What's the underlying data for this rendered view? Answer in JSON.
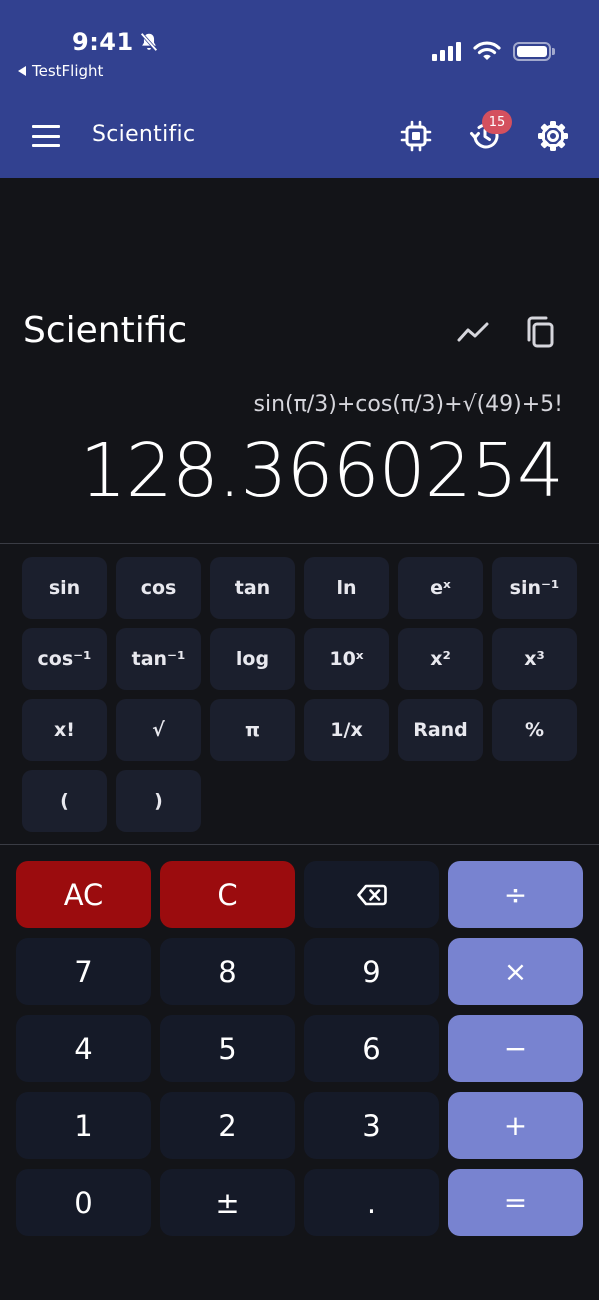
{
  "status_bar": {
    "time": "9:41",
    "back_app": "TestFlight"
  },
  "app_bar": {
    "title": "Scientific",
    "history_badge": "15"
  },
  "display": {
    "mode_title": "Scientific",
    "expression": "sin(π/3)+cos(π/3)+√(49)+5!",
    "result": "128.3660254"
  },
  "scientific_keys": [
    "sin",
    "cos",
    "tan",
    "ln",
    "eˣ",
    "sin⁻¹",
    "cos⁻¹",
    "tan⁻¹",
    "log",
    "10ˣ",
    "x²",
    "x³",
    "x!",
    "√",
    "π",
    "1/x",
    "Rand",
    "%",
    "(",
    ")"
  ],
  "keypad": {
    "ac": "AC",
    "c": "C",
    "divide": "÷",
    "multiply": "×",
    "minus": "−",
    "plus": "+",
    "equals": "=",
    "n7": "7",
    "n8": "8",
    "n9": "9",
    "n4": "4",
    "n5": "5",
    "n6": "6",
    "n1": "1",
    "n2": "2",
    "n3": "3",
    "n0": "0",
    "plus_minus": "±",
    "dot": "."
  },
  "colors": {
    "app_bar": "#324190",
    "background": "#131418",
    "clear_key": "#9b0c0e",
    "operator_key": "#7883d0",
    "badge": "#d4505e"
  },
  "icons": {
    "menu": "menu-icon",
    "processor": "chip-icon",
    "history": "history-icon",
    "settings": "gear-icon",
    "graph": "trend-line-icon",
    "copy": "copy-icon",
    "backspace": "backspace-icon"
  }
}
